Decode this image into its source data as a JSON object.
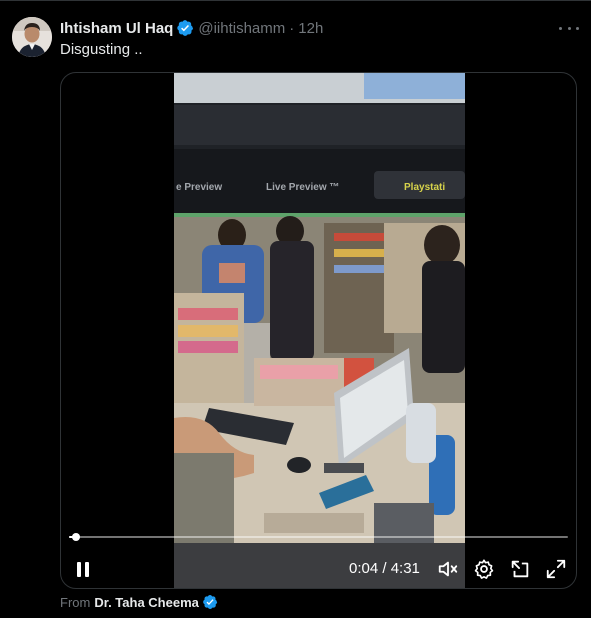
{
  "tweet": {
    "display_name": "Ihtisham Ul Haq",
    "handle": "@iihtishamm",
    "separator": "·",
    "time": "12h",
    "text": "Disgusting ..",
    "verified": true
  },
  "video": {
    "current_time": "0:04",
    "duration": "4:31",
    "time_display": "0:04 / 4:31",
    "progress_fraction": 0.015,
    "state": "playing",
    "overlay_texts": [
      "e Preview",
      "Live Preview ™",
      "Playstati"
    ],
    "controls": {
      "pause_icon": "pause-icon",
      "mute_icon": "volume-muted-icon",
      "settings_icon": "gear-icon",
      "pip_icon": "picture-in-picture-icon",
      "fullscreen_icon": "fullscreen-icon"
    }
  },
  "attribution": {
    "label": "From",
    "name": "Dr. Taha Cheema",
    "verified": true
  },
  "colors": {
    "background": "#000000",
    "text_primary": "#e7e9ea",
    "text_secondary": "#71767b",
    "verified_blue": "#1d9bf0",
    "border": "#2f3336"
  }
}
